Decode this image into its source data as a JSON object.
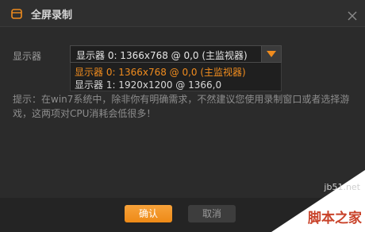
{
  "window": {
    "title": "全屏录制"
  },
  "display": {
    "label": "显示器",
    "selected": "显示器 0: 1366x768 @ 0,0 (主监视器)",
    "options": [
      "显示器 0: 1366x768 @ 0,0 (主监视器)",
      "显示器 1: 1920x1200 @ 1366,0"
    ]
  },
  "tip": "提示：在win7系统中，除非你有明确需求，不然建议您使用录制窗口或者选择游戏，这两项对CPU消耗会低很多！",
  "buttons": {
    "confirm": "确认",
    "cancel": "取消"
  },
  "watermark": {
    "url": "jb51.net",
    "name": "脚本之家"
  },
  "colors": {
    "accent": "#f08c1e",
    "background": "#2b2b2b"
  },
  "icons": {
    "title": "record-window-icon",
    "close": "close-icon",
    "dropdown": "dropdown-arrow-icon"
  }
}
